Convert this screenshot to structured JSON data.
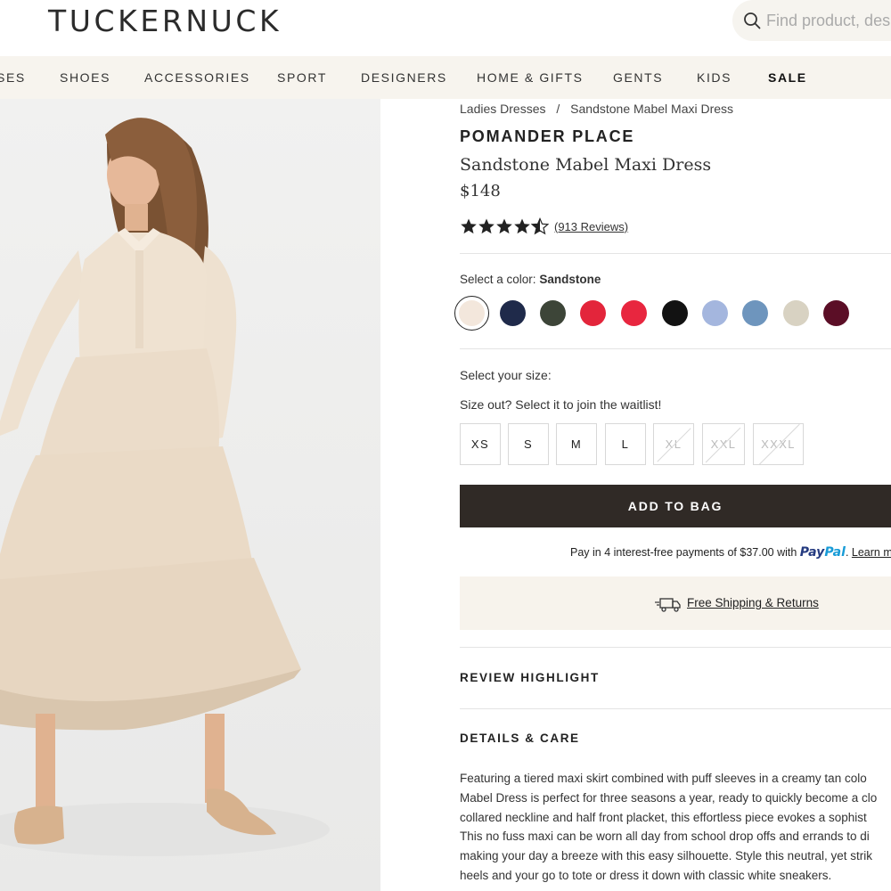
{
  "header": {
    "logo": "TUCKERNUCK",
    "search_placeholder": "Find product, des"
  },
  "nav": {
    "items": [
      "SES",
      "SHOES",
      "ACCESSORIES",
      "SPORT",
      "DESIGNERS",
      "HOME & GIFTS",
      "GENTS",
      "KIDS",
      "SALE"
    ]
  },
  "breadcrumb": {
    "parent": "Ladies Dresses",
    "separator": "/",
    "current": "Sandstone Mabel Maxi Dress"
  },
  "product": {
    "brand": "POMANDER PLACE",
    "name": "Sandstone Mabel Maxi Dress",
    "price": "$148",
    "rating": 4.5,
    "rating_max": 5,
    "reviews_label": "(913 Reviews)"
  },
  "color": {
    "label": "Select a color:",
    "selected": "Sandstone",
    "swatches": [
      "#f3e7dc",
      "#1f2a4a",
      "#3d4538",
      "#e3253b",
      "#e8263f",
      "#121212",
      "#a4b6de",
      "#6e95bd",
      "#d8d2c2",
      "#5b0e26"
    ]
  },
  "size": {
    "label": "Select your size:",
    "note": "Size out? Select it to join the waitlist!",
    "options": [
      {
        "label": "XS",
        "available": true
      },
      {
        "label": "S",
        "available": true
      },
      {
        "label": "M",
        "available": true
      },
      {
        "label": "L",
        "available": true
      },
      {
        "label": "XL",
        "available": false
      },
      {
        "label": "XXL",
        "available": false
      },
      {
        "label": "XXXL",
        "available": false
      }
    ]
  },
  "cart": {
    "add_label": "ADD TO BAG"
  },
  "paypal": {
    "text": "Pay in 4 interest-free payments of $37.00 with",
    "brand_pay": "Pay",
    "brand_pal": "Pal",
    "learn": "Learn m"
  },
  "shipping": {
    "label": "Free Shipping & Returns"
  },
  "sections": {
    "review_highlight": "REVIEW HIGHLIGHT",
    "details_care": "DETAILS & CARE"
  },
  "description": {
    "lines": [
      "Featuring a tiered maxi skirt combined with puff sleeves in a creamy tan colo",
      "Mabel Dress is perfect for three seasons a year, ready to quickly become a clo",
      "collared neckline and half front placket, this effortless piece evokes a sophist",
      "This no fuss maxi can be worn all day from school drop offs and errands to di",
      "making your day a breeze with this easy silhouette. Style this neutral, yet strik",
      "heels and your go to tote or dress it down with classic white sneakers."
    ]
  },
  "colors": {
    "nav_bg": "#f7f4ee",
    "button_dark": "#302a26",
    "ship_bg": "#f7f3ec",
    "dress": "#ecdcc8"
  }
}
